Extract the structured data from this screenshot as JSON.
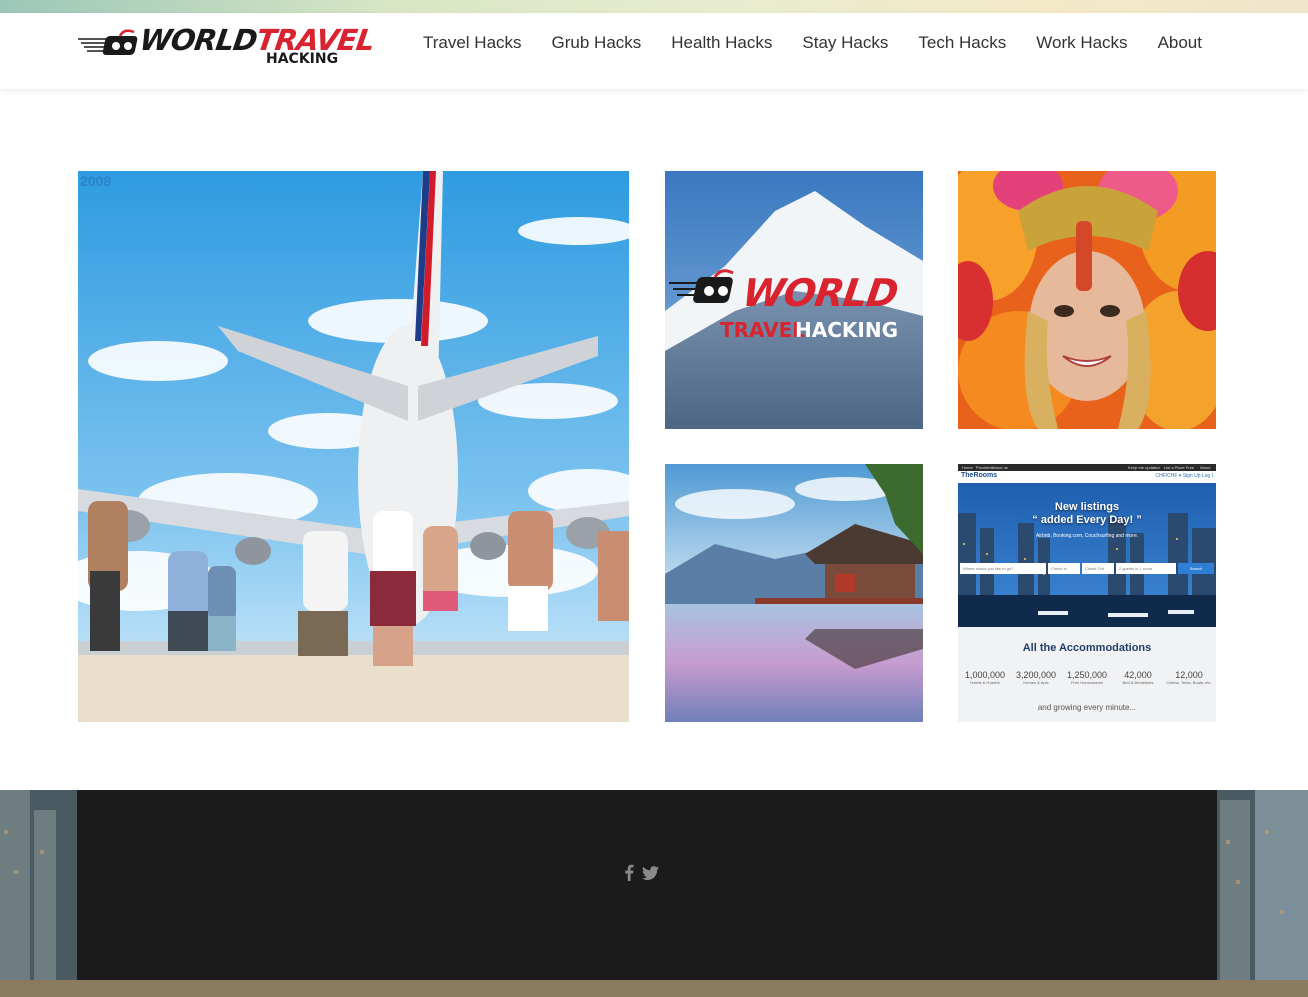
{
  "brand": {
    "logo_word1": "WORLD",
    "logo_word2": "TRAVEL",
    "logo_sub": "HACKING",
    "accent": "#d9232e",
    "dark": "#1a1a1a"
  },
  "nav": {
    "items": [
      {
        "label": "Travel Hacks"
      },
      {
        "label": "Grub Hacks"
      },
      {
        "label": "Health Hacks"
      },
      {
        "label": "Stay Hacks"
      },
      {
        "label": "Tech Hacks"
      },
      {
        "label": "Work Hacks"
      },
      {
        "label": "About"
      }
    ]
  },
  "gallery": {
    "featured": {
      "watermark": "2008"
    },
    "logo_tile": {
      "word1": "WORLD",
      "word2": "TRAVEL",
      "word3": "HACKING"
    },
    "rooms_tile": {
      "topbar": {
        "left": [
          "Home",
          "Providers",
          "About us"
        ],
        "right": [
          "Keep me updated",
          "List a Place Free",
          "About"
        ]
      },
      "brand": "TheRooms",
      "links": "CHF/CHF ▾   Sign Up   Log I",
      "headline_1": "New listings",
      "headline_2": "“ added Every Day! ”",
      "subline": "Airbnb, Booking.com, Couchsurfing and more.",
      "search": {
        "where": "Where would you like to go?",
        "check_in": "Check In",
        "check_out": "Check Out",
        "guests": "2 guests in 1 room",
        "button": "Search"
      },
      "title": "All the Accommodations",
      "stats": [
        {
          "num": "1,000,000",
          "label": "Hotels & Hostels"
        },
        {
          "num": "3,200,000",
          "label": "Homes & Apts"
        },
        {
          "num": "1,250,000",
          "label": "Free Homeshares"
        },
        {
          "num": "42,000",
          "label": "Bed & Breakfasts"
        },
        {
          "num": "12,000",
          "label": "Cabins, Tents, Boats, etc."
        }
      ],
      "footer": "and growing every minute..."
    }
  },
  "footer": {
    "social": [
      {
        "icon": "facebook-icon",
        "glyph": "f"
      },
      {
        "icon": "twitter-icon",
        "glyph": "t"
      }
    ],
    "icon_color": "#8a8a8a"
  }
}
